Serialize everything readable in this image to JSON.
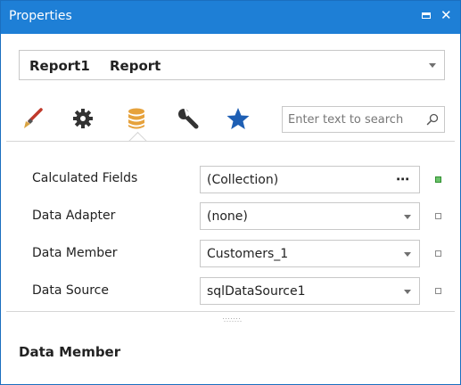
{
  "window": {
    "title": "Properties",
    "maximize_icon": "maximize-icon",
    "close_glyph": "✕"
  },
  "object_selector": {
    "name": "Report1",
    "type": "Report"
  },
  "tabs": [
    {
      "icon": "brush-icon",
      "color": "#c0392b"
    },
    {
      "icon": "gear-icon",
      "color": "#333333"
    },
    {
      "icon": "database-icon",
      "color": "#e6a23c",
      "selected": true
    },
    {
      "icon": "wrench-icon",
      "color": "#333333"
    },
    {
      "icon": "star-icon",
      "color": "#1e5fb4"
    }
  ],
  "search": {
    "placeholder": "Enter text to search"
  },
  "properties": [
    {
      "label": "Calculated Fields",
      "value": "(Collection)",
      "editor": "ellipsis",
      "ellipsis": "⋯",
      "modified": true
    },
    {
      "label": "Data Adapter",
      "value": "(none)",
      "editor": "dropdown",
      "modified": false
    },
    {
      "label": "Data Member",
      "value": "Customers_1",
      "editor": "dropdown",
      "modified": false
    },
    {
      "label": "Data Source",
      "value": "sqlDataSource1",
      "editor": "dropdown",
      "modified": false
    }
  ],
  "description": {
    "title": "Data Member"
  },
  "colors": {
    "titlebar": "#1e7fd6",
    "modified_marker": "#6ac26a"
  }
}
